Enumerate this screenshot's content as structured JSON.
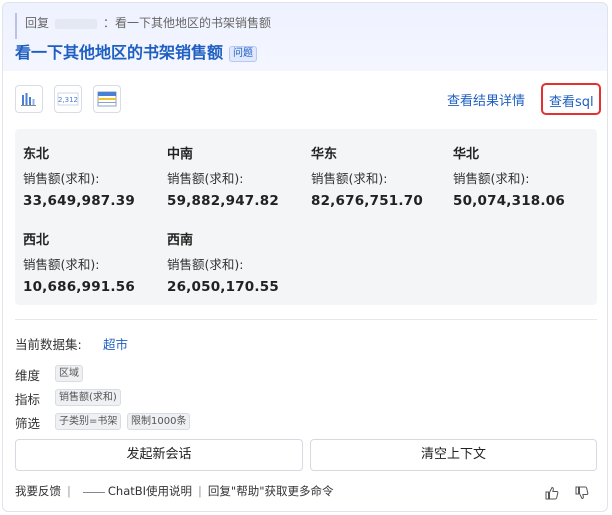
{
  "header": {
    "reply_prefix": "回复",
    "reply_colon": "：",
    "reply_text": "看一下其他地区的书架销售额",
    "title": "看一下其他地区的书架销售额",
    "badge": "问题"
  },
  "toolbar": {
    "tools": [
      "bar-chart-icon",
      "number-card-icon",
      "table-icon"
    ],
    "result_details_link": "查看结果详情",
    "sql_link": "查看sql"
  },
  "results": [
    {
      "region": "东北",
      "metric": "销售额(求和):",
      "value": "33,649,987.39"
    },
    {
      "region": "中南",
      "metric": "销售额(求和):",
      "value": "59,882,947.82"
    },
    {
      "region": "华东",
      "metric": "销售额(求和):",
      "value": "82,676,751.70"
    },
    {
      "region": "华北",
      "metric": "销售额(求和):",
      "value": "50,074,318.06"
    },
    {
      "region": "西北",
      "metric": "销售额(求和):",
      "value": "10,686,991.56"
    },
    {
      "region": "西南",
      "metric": "销售额(求和):",
      "value": "26,050,170.55"
    }
  ],
  "dataset": {
    "label": "当前数据集:",
    "name": "超市"
  },
  "props": {
    "dimension_label": "维度",
    "dimension_tag": "区域",
    "metric_label": "指标",
    "metric_tag": "销售额(求和)",
    "filter_label": "筛选",
    "filter_tags": [
      "子类别=书架",
      "限制1000条"
    ]
  },
  "actions": {
    "new_session": "发起新会话",
    "clear_context": "清空上下文"
  },
  "footer": {
    "feedback": "我要反馈",
    "sep": "|",
    "guide": "ChatBI使用说明",
    "help": "回复\"帮助\"获取更多命令"
  },
  "colors": {
    "accent": "#1f5fc1",
    "highlight": "#e53030",
    "panel": "#f4f5f7"
  }
}
